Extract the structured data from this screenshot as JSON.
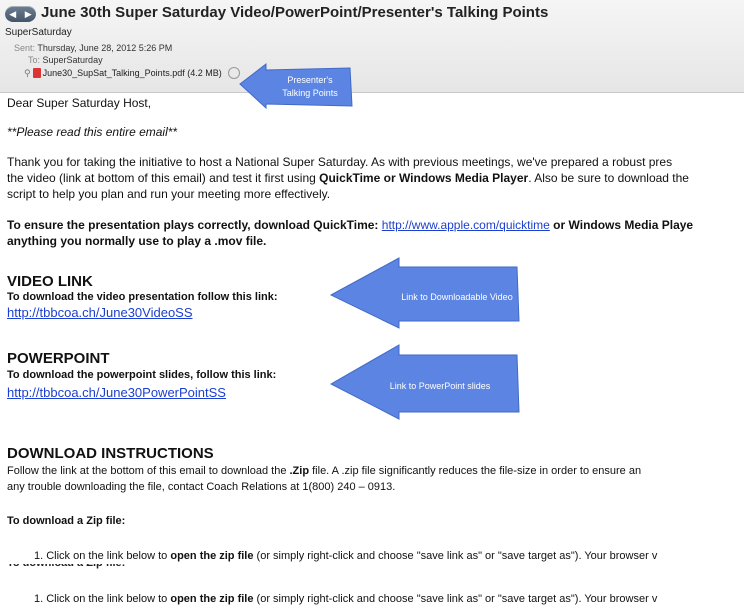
{
  "email": {
    "subject": "June 30th Super Saturday Video/PowerPoint/Presenter's Talking Points",
    "from": "SuperSaturday",
    "sent_label": "Sent:",
    "sent_value": "Thursday, June 28, 2012 5:26 PM",
    "to_label": "To:",
    "to_value": "SuperSaturday",
    "attachment": "June30_SupSat_Talking_Points.pdf (4.2 MB)"
  },
  "callouts": {
    "presenter_line1": "Presenter's",
    "presenter_line2": "Talking Points",
    "video": "Link to Downloadable Video",
    "powerpoint": "Link to PowerPoint slides"
  },
  "body": {
    "greeting": "Dear Super Saturday Host,",
    "please_read": "**Please read this entire email**",
    "p1_line1": "Thank you for taking the initiative to host a National Super Saturday. As with previous meetings, we've prepared a robust pres",
    "p1_line2_a": "the video (link at bottom of this email) and test it first using ",
    "p1_line2_b": "QuickTime or Windows Media Player",
    "p1_line2_c": ". Also be sure to download the",
    "p1_line3": "script to help you plan and run your meeting more effectively.",
    "ensure_a": "To ensure the presentation plays correctly, download QuickTime: ",
    "ensure_link": "http://www.apple.com/quicktime",
    "ensure_b": " or Windows Media Playe",
    "ensure_line2": "anything you normally use to play a .mov file.",
    "video_title": "VIDEO LINK",
    "video_instr": "To download the video presentation follow this link:",
    "video_url": "http://tbbcoa.ch/June30VideoSS",
    "pp_title": "POWERPOINT",
    "pp_instr": "To download the powerpoint slides, follow this link:",
    "pp_url": "http://tbbcoa.ch/June30PowerPointSS",
    "dl_title": "DOWNLOAD INSTRUCTIONS",
    "dl_line1_a": "Follow the link at the bottom of this email to download the ",
    "dl_line1_b": ".Zip",
    "dl_line1_c": " file. A .zip file significantly reduces the file-size in order to ensure an",
    "dl_line2": "any trouble downloading the file, contact Coach Relations at 1(800) 240 – 0913.",
    "zip_head": "To download a Zip file:",
    "step1_a": "1. Click on the link below to ",
    "step1_b": "open the zip file",
    "step1_c": " (or simply right-click and choose \"save link as\" or \"save target as\").  Your browser v",
    "zip_head_dup": "To download a Zip file:",
    "step1b_a": "1. Click on the link below to ",
    "step1b_b": "open the zip file",
    "step1b_c": " (or simply right-click and choose \"save link as\" or \"save target as\").  Your browser v"
  }
}
